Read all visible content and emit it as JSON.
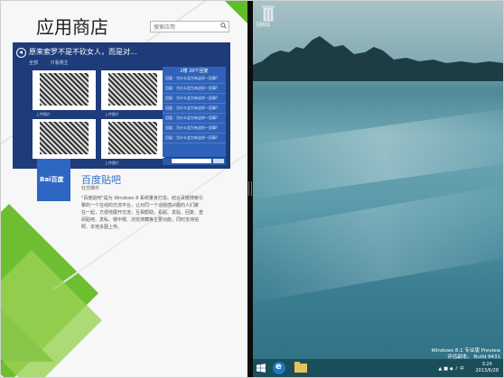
{
  "store": {
    "title": "应用商店",
    "search_placeholder": "搜索应用",
    "featured": {
      "headline": "原来索罗不是不砍女人，而是对...",
      "tabs": [
        "全部",
        "只看楼主"
      ],
      "posts": [
        {
          "caption": "上传图片"
        },
        {
          "caption": "上传图片"
        },
        {
          "caption": "上传图片"
        },
        {
          "caption": "上传图片"
        }
      ],
      "side_header": "2楼 20个回复",
      "side_items": [
        "回复：为什么会为有这样一回事?",
        "回复：为什么会为有这样一回事?",
        "回复：为什么会为有这样一回事?",
        "回复：为什么会为有这样一回事?",
        "回复：为什么会为有这样一回事?",
        "回复：为什么会为有这样一回事?",
        "回复：为什么会为有这样一回事?"
      ],
      "side_footer": "分享评论"
    },
    "app": {
      "logo_text": "Bai百度",
      "name": "百度贴吧",
      "category": "社交娱乐",
      "description": [
        "\"百度贴吧\"是为 Windows 8 系统量身打造。结合百度搜索引",
        "擎的一个在线的交流平台，让对同一个话题感兴趣的人们聚",
        "在一起，方便地展开交流，互相帮助。看贴、发贴、回复、查",
        "阅贴吧、发私、楼中楼、浏览搜藏等主要功能，同时支持拍",
        "照、本地多图上传。"
      ]
    }
  },
  "desktop": {
    "recycle_label": "回收站",
    "watermark": [
      "Windows 8.1 专业版 Preview",
      "评估副本。 Build 9431"
    ],
    "clock_time": "3:26",
    "clock_date": "2013/6/28",
    "tray_icons": [
      "▲",
      "■",
      "◆",
      "♪",
      "中"
    ]
  },
  "colors": {
    "store_green": "#6ebe32",
    "store_blue": "#2f6fcf",
    "card_navy": "#1e3b7a",
    "taskbar": "#1a4e5a"
  }
}
